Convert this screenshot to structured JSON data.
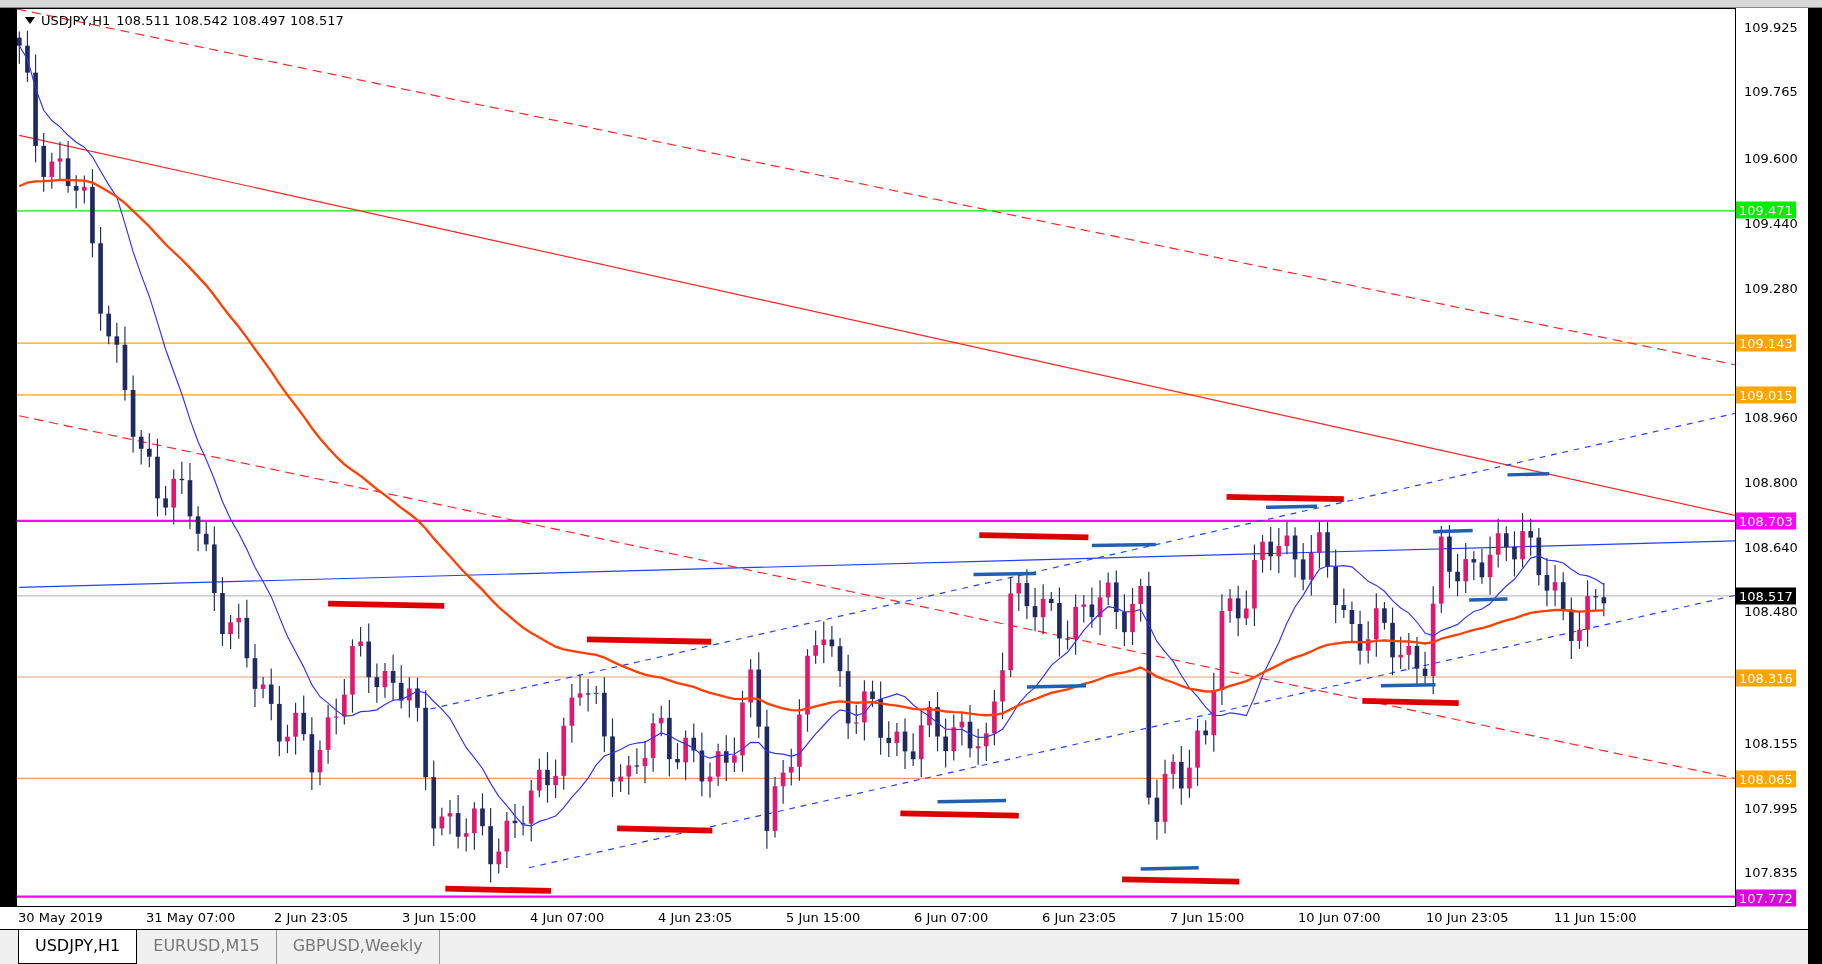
{
  "chart_header": {
    "symbol": "USDJPY,H1",
    "ohlc": "108.511 108.542 108.497 108.517"
  },
  "price_axis": [
    "109.925",
    "109.765",
    "109.600",
    "109.440",
    "109.280",
    "108.960",
    "108.800",
    "108.640",
    "108.480",
    "108.155",
    "107.995",
    "107.835"
  ],
  "level_labels": [
    {
      "text": "109.471",
      "color": "#00ee00"
    },
    {
      "text": "109.143",
      "color": "#ffa500"
    },
    {
      "text": "109.015",
      "color": "#ffa500"
    },
    {
      "text": "108.703",
      "color": "#ff00ff"
    },
    {
      "text": "108.517",
      "color": "#000000"
    },
    {
      "text": "108.316",
      "color": "#ffa500"
    },
    {
      "text": "108.065",
      "color": "#ffa500"
    },
    {
      "text": "107.772",
      "color": "#e000e0"
    }
  ],
  "time_axis": [
    "30 May 2019",
    "31 May 07:00",
    "2 Jun 23:05",
    "3 Jun 15:00",
    "4 Jun 07:00",
    "4 Jun 23:05",
    "5 Jun 15:00",
    "6 Jun 07:00",
    "6 Jun 23:05",
    "7 Jun 15:00",
    "10 Jun 07:00",
    "10 Jun 23:05",
    "11 Jun 15:00"
  ],
  "tabs": [
    {
      "label": "USDJPY,H1",
      "selected": true
    },
    {
      "label": "EURUSD,M15",
      "selected": false
    },
    {
      "label": "GBPUSD,Weekly",
      "selected": false
    }
  ]
}
